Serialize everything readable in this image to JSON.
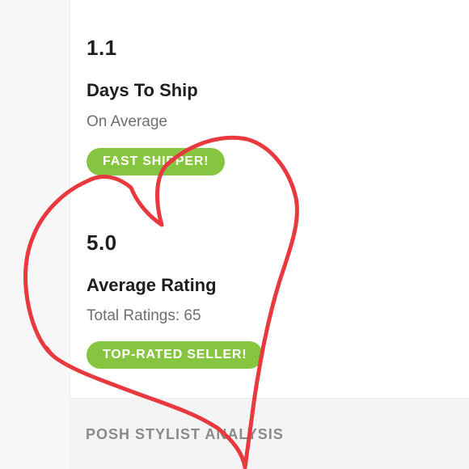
{
  "ship_stat": {
    "value": "1.1",
    "title": "Days To Ship",
    "subtitle": "On Average",
    "badge": "FAST SHIPPER!"
  },
  "rating_stat": {
    "value": "5.0",
    "title": "Average Rating",
    "subtitle": "Total Ratings: 65",
    "badge": "TOP-RATED SELLER!"
  },
  "footer": {
    "section_heading": "POSH STYLIST ANALYSIS"
  },
  "colors": {
    "badge_green": "#86c540",
    "heart_stroke": "#e8393f",
    "heading_gray": "#8a8a8a"
  },
  "overlay": {
    "drawing": "heart-icon"
  }
}
